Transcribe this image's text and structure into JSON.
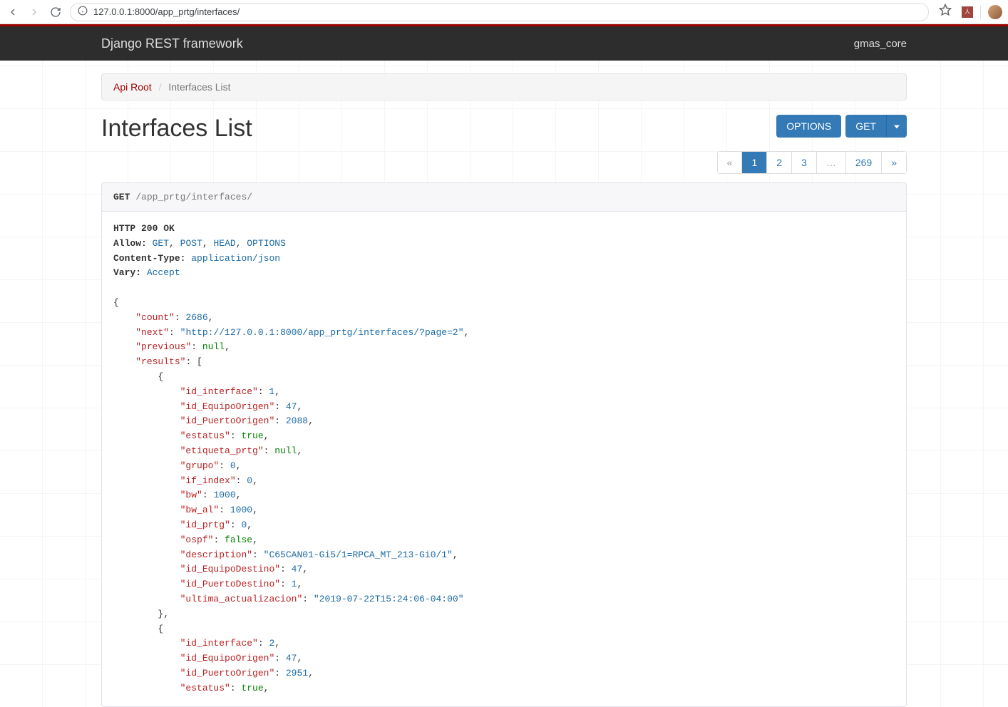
{
  "browser": {
    "url": "127.0.0.1:8000/app_prtg/interfaces/",
    "pdf_text": "人"
  },
  "navbar": {
    "brand": "Django REST framework",
    "user": "gmas_core"
  },
  "breadcrumb": {
    "root": "Api Root",
    "sep": "/",
    "current": "Interfaces List"
  },
  "page_title": "Interfaces List",
  "buttons": {
    "options": "OPTIONS",
    "get": "GET"
  },
  "pagination": {
    "prev": "«",
    "pages": [
      "1",
      "2",
      "3",
      "…",
      "269"
    ],
    "active_index": 0,
    "next": "»"
  },
  "request": {
    "method": "GET",
    "path": "/app_prtg/interfaces/"
  },
  "response": {
    "status_line": "HTTP 200 OK",
    "headers": [
      {
        "k": "Allow:",
        "v": "GET, POST, HEAD, OPTIONS"
      },
      {
        "k": "Content-Type:",
        "v": "application/json"
      },
      {
        "k": "Vary:",
        "v": "Accept"
      }
    ],
    "body": {
      "count": 2686,
      "next": "http://127.0.0.1:8000/app_prtg/interfaces/?page=2",
      "previous": null,
      "results": [
        {
          "id_interface": 1,
          "id_EquipoOrigen": 47,
          "id_PuertoOrigen": 2088,
          "estatus": true,
          "etiqueta_prtg": null,
          "grupo": 0,
          "if_index": 0,
          "bw": 1000,
          "bw_al": 1000,
          "id_prtg": 0,
          "ospf": false,
          "description": "C65CAN01-Gi5/1=RPCA_MT_213-Gi0/1",
          "id_EquipoDestino": 47,
          "id_PuertoDestino": 1,
          "ultima_actualizacion": "2019-07-22T15:24:06-04:00"
        },
        {
          "id_interface": 2,
          "id_EquipoOrigen": 47,
          "id_PuertoOrigen": 2951,
          "estatus": true
        }
      ]
    }
  }
}
